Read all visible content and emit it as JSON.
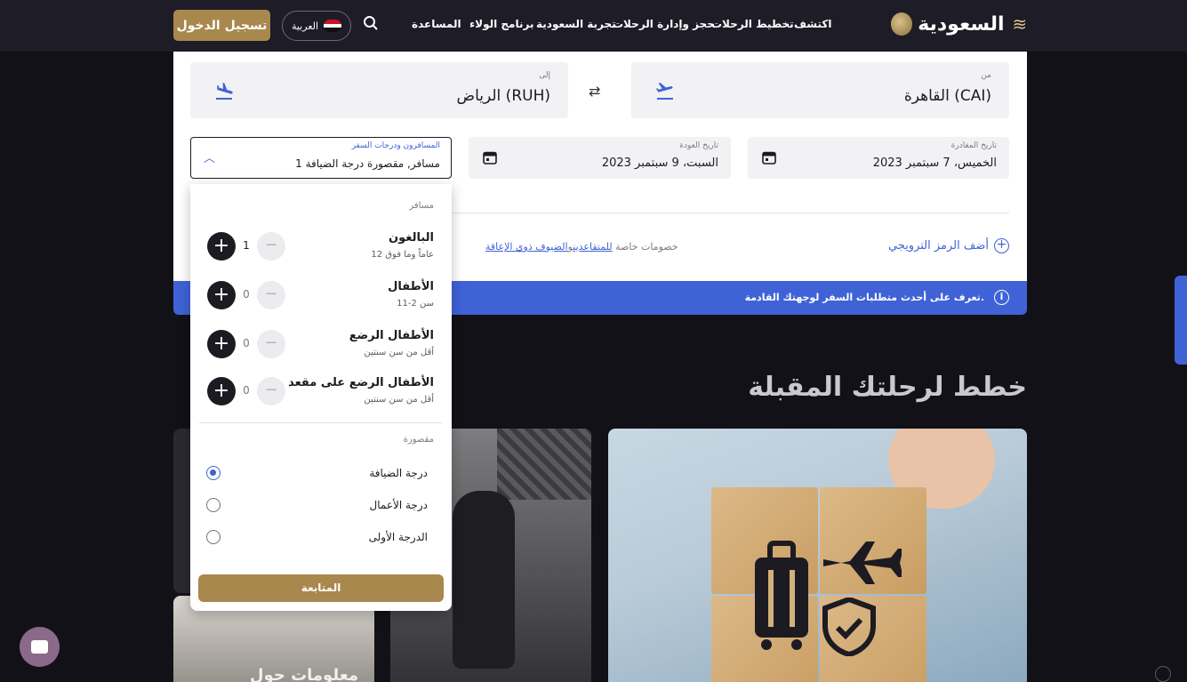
{
  "header": {
    "logo_text": "السعودية",
    "nav": [
      "اكتشف",
      "تخطيط الرحلات",
      "حجز وإدارة الرحلات",
      "تجربة السعودية",
      "برنامج الولاء",
      "المساعدة"
    ],
    "language_label": "العربية",
    "login_label": "تسجيل الدخول"
  },
  "booking": {
    "from_label": "من",
    "from_value": "القاهرة (CAI)",
    "to_label": "إلى",
    "to_value": "الرياض (RUH)",
    "departure_label": "تاريخ المغادرة",
    "departure_value": "الخميس، 7 سبتمبر 2023",
    "return_label": "تاريخ العودة",
    "return_value": "السبت، 9 سبتمبر 2023",
    "pax_label": "المسافرون ودرجات السفر",
    "pax_value": "1 مسافر, مقصورة درجة الضيافة",
    "promo_label": "أضف الرمز الترويجي",
    "discounts_prefix": "خصومات خاصة",
    "discounts_seniors": "للمتقاعدين",
    "discounts_and": "و",
    "discounts_disabled": "الضيوف ذوي الإعاقة"
  },
  "banner": {
    "text": "تعرف على أحدث متطلبات السفر لوجهتك القادمة."
  },
  "section": {
    "title": "خطط لرحلتك المقبلة",
    "card4_title": "معلومات حول"
  },
  "dropdown": {
    "travelers_heading": "مسافر",
    "travelers": [
      {
        "name": "البالغون",
        "sub": "12 عاماً وما فوق",
        "count": "1"
      },
      {
        "name": "الأطفال",
        "sub": "سن 2-11",
        "count": "0"
      },
      {
        "name": "الأطفال الرضع",
        "sub": "أقل من سن سنتين",
        "count": "0"
      },
      {
        "name": "الأطفال الرضع على مقعد",
        "sub": "أقل من سن سنتين",
        "count": "0"
      }
    ],
    "cabin_heading": "مقصورة",
    "cabins": [
      "درجة الضيافة",
      "درجة الأعمال",
      "الدرجة الأولى"
    ],
    "continue_label": "المتابعة"
  },
  "colors": {
    "brand_gold": "#a8884d",
    "accent_blue": "#3f63d6",
    "header_bg": "#1d1c27",
    "page_bg": "#121118"
  }
}
